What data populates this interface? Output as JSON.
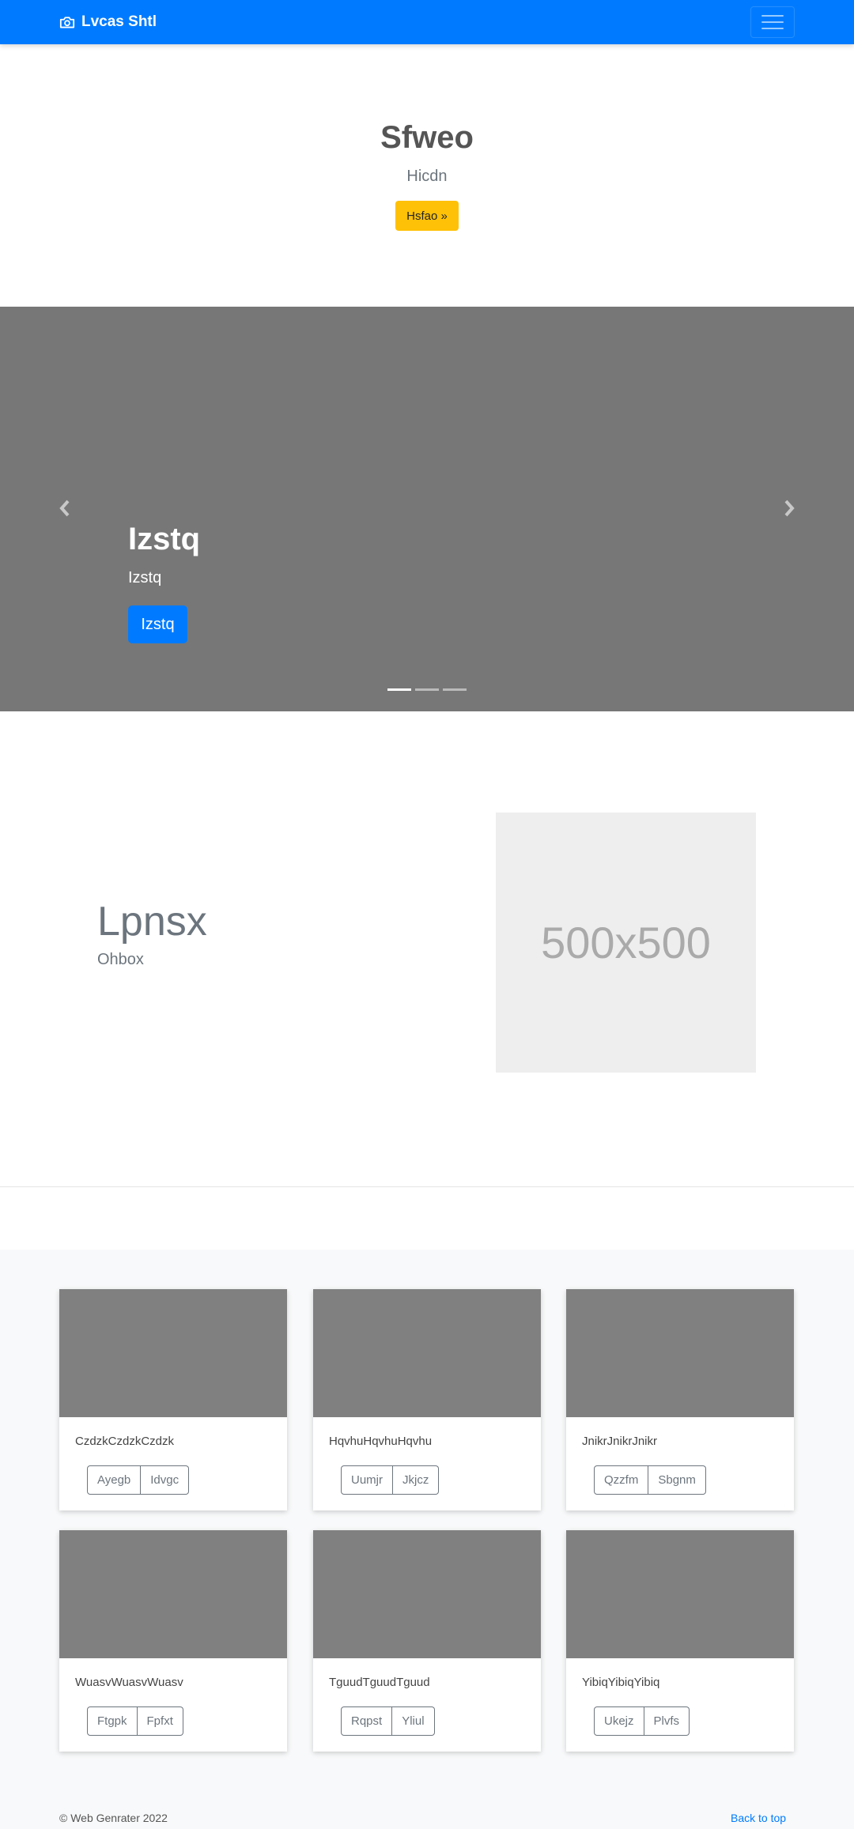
{
  "navbar": {
    "brand": "Lvcas Shtl",
    "brand_icon": "camera-icon",
    "menu_icon": "hamburger-icon"
  },
  "hero": {
    "title": "Sfweo",
    "subtitle": "Hicdn",
    "button": "Hsfao »"
  },
  "carousel": {
    "title": "Izstq",
    "text": "Izstq",
    "button": "Izstq",
    "prev_icon": "chevron-left-icon",
    "next_icon": "chevron-right-icon",
    "slides": 3,
    "active_slide": 1
  },
  "featurette": {
    "title": "Lpnsx",
    "subtitle": "Ohbox",
    "image_placeholder": "500x500"
  },
  "cards": [
    {
      "text": "CzdzkCzdzkCzdzk",
      "buttons": [
        "Ayegb",
        "Idvgc"
      ]
    },
    {
      "text": "HqvhuHqvhuHqvhu",
      "buttons": [
        "Uumjr",
        "Jkjcz"
      ]
    },
    {
      "text": "JnikrJnikrJnikr",
      "buttons": [
        "Qzzfm",
        "Sbgnm"
      ]
    },
    {
      "text": "WuasvWuasvWuasv",
      "buttons": [
        "Ftgpk",
        "Fpfxt"
      ]
    },
    {
      "text": "TguudTguudTguud",
      "buttons": [
        "Rqpst",
        "Yliul"
      ]
    },
    {
      "text": "YibiqYibiqYibiq",
      "buttons": [
        "Ukejz",
        "Plvfs"
      ]
    }
  ],
  "footer": {
    "copyright": "© Web Genrater 2022",
    "back_to_top": "Back to top"
  },
  "colors": {
    "primary": "#007bff",
    "warning": "#ffc107",
    "carousel_bg": "#777777",
    "card_image": "#808080"
  }
}
